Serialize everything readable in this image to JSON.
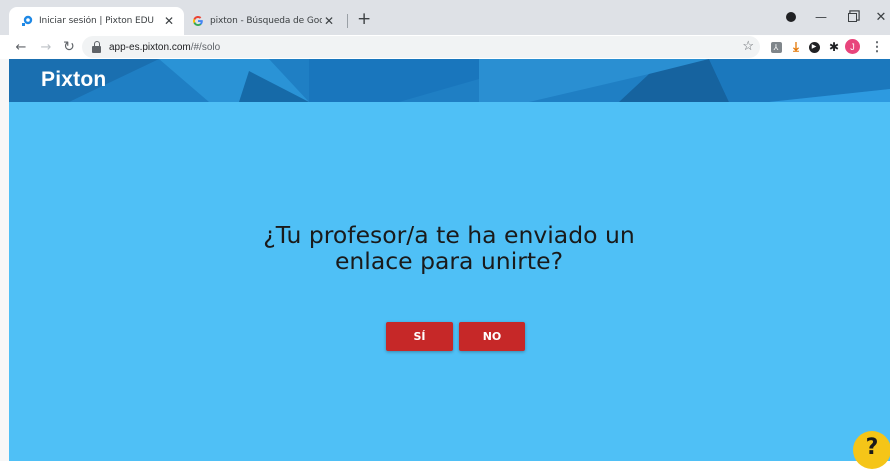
{
  "browser": {
    "tabs": [
      {
        "title": "Iniciar sesión | Pixton EDU",
        "active": true,
        "icon": "pixton-favicon-icon"
      },
      {
        "title": "pixton - Búsqueda de Google",
        "active": false,
        "icon": "google-favicon-icon"
      }
    ],
    "url_host": "app-es.pixton.com",
    "url_path": "/#/solo",
    "avatar_letter": "J",
    "colors": {
      "tabstrip": "#dee1e6",
      "avatar": "#e8457c"
    }
  },
  "page": {
    "logo": "Pixton",
    "question": "¿Tu profesor/a te ha enviado un enlace para unirte?",
    "yes_label": "SÍ",
    "no_label": "NO",
    "help_label": "?",
    "colors": {
      "header": "#1f7fc4",
      "background": "#4fc0f6",
      "button": "#c62828",
      "help": "#f5c518"
    }
  }
}
